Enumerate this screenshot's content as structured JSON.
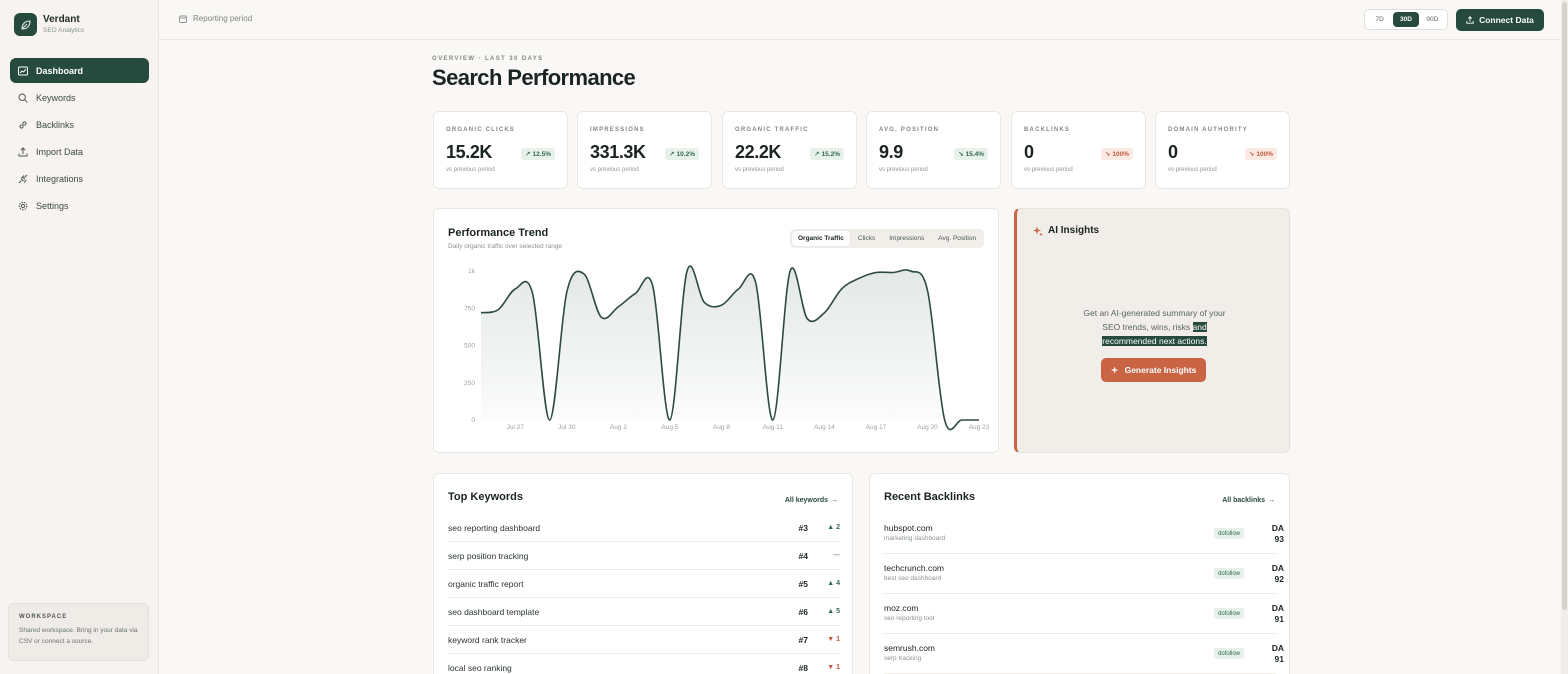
{
  "brand": {
    "name": "Verdant",
    "subtitle": "SEO Analytics"
  },
  "sidebar": {
    "items": [
      {
        "label": "Dashboard",
        "icon": "dashboard-icon",
        "active": true
      },
      {
        "label": "Keywords",
        "icon": "search-icon"
      },
      {
        "label": "Backlinks",
        "icon": "link-icon"
      },
      {
        "label": "Import Data",
        "icon": "upload-icon"
      },
      {
        "label": "Integrations",
        "icon": "plug-icon"
      },
      {
        "label": "Settings",
        "icon": "gear-icon"
      }
    ],
    "workspace": {
      "title": "WORKSPACE",
      "text": "Shared workspace. Bring in your data via CSV or connect a source."
    }
  },
  "topbar": {
    "period_label": "Reporting period",
    "ranges": [
      "7D",
      "30D",
      "90D"
    ],
    "active_range": "30D",
    "connect_label": "Connect Data"
  },
  "header": {
    "eyebrow": "OVERVIEW · LAST 30 DAYS",
    "title": "Search Performance"
  },
  "kpis": [
    {
      "label": "ORGANIC CLICKS",
      "value": "15.2K",
      "change": "12.5%",
      "direction": "up",
      "sub": "vs previous period"
    },
    {
      "label": "IMPRESSIONS",
      "value": "331.3K",
      "change": "10.2%",
      "direction": "up",
      "sub": "vs previous period"
    },
    {
      "label": "ORGANIC TRAFFIC",
      "value": "22.2K",
      "change": "15.2%",
      "direction": "up",
      "sub": "vs previous period"
    },
    {
      "label": "AVG. POSITION",
      "value": "9.9",
      "change": "15.4%",
      "direction": "up",
      "sub": "vs previous period"
    },
    {
      "label": "BACKLINKS",
      "value": "0",
      "change": "100%",
      "direction": "down",
      "sub": "vs previous period"
    },
    {
      "label": "DOMAIN AUTHORITY",
      "value": "0",
      "change": "100%",
      "direction": "down",
      "sub": "vs previous period"
    }
  ],
  "performance": {
    "title": "Performance Trend",
    "subtitle": "Daily organic traffic over selected range",
    "tabs": [
      "Organic Traffic",
      "Clicks",
      "Impressions",
      "Avg. Position"
    ],
    "active_tab": "Organic Traffic"
  },
  "chart_data": {
    "type": "area",
    "title": "Performance Trend",
    "xlabel": "",
    "ylabel": "",
    "ylim": [
      0,
      1000
    ],
    "yticks": [
      "0",
      "250",
      "500",
      "750",
      "1k"
    ],
    "xtick_labels": [
      "Jul 27",
      "Jul 30",
      "Aug 2",
      "Aug 5",
      "Aug 8",
      "Aug 11",
      "Aug 14",
      "Aug 17",
      "Aug 20",
      "Aug 23"
    ],
    "x": [
      "Jul 25",
      "Jul 26",
      "Jul 27",
      "Jul 28",
      "Jul 29",
      "Jul 30",
      "Jul 31",
      "Aug 1",
      "Aug 2",
      "Aug 3",
      "Aug 4",
      "Aug 5",
      "Aug 6",
      "Aug 7",
      "Aug 8",
      "Aug 9",
      "Aug 10",
      "Aug 11",
      "Aug 12",
      "Aug 13",
      "Aug 14",
      "Aug 15",
      "Aug 16",
      "Aug 17",
      "Aug 18",
      "Aug 19",
      "Aug 20",
      "Aug 21",
      "Aug 22",
      "Aug 23"
    ],
    "series": [
      {
        "values": [
          720,
          740,
          880,
          850,
          0,
          860,
          980,
          690,
          760,
          850,
          900,
          0,
          1000,
          790,
          770,
          880,
          920,
          0,
          1000,
          680,
          720,
          880,
          950,
          990,
          990,
          1000,
          870,
          0,
          0,
          0
        ]
      }
    ],
    "grid": false,
    "legend": "none"
  },
  "ai": {
    "title": "AI Insights",
    "text_before": "Get an AI-generated summary of your SEO trends, wins, risks ",
    "text_highlight": "and recommended next actions.",
    "button": "Generate Insights"
  },
  "keywords": {
    "title": "Top Keywords",
    "link": "All keywords",
    "rows": [
      {
        "keyword": "seo reporting dashboard",
        "rank": "#3",
        "change": "2",
        "direction": "up"
      },
      {
        "keyword": "serp position tracking",
        "rank": "#4",
        "change": "—",
        "direction": "flat"
      },
      {
        "keyword": "organic traffic report",
        "rank": "#5",
        "change": "4",
        "direction": "up"
      },
      {
        "keyword": "seo dashboard template",
        "rank": "#6",
        "change": "5",
        "direction": "up"
      },
      {
        "keyword": "keyword rank tracker",
        "rank": "#7",
        "change": "1",
        "direction": "down"
      },
      {
        "keyword": "local seo ranking",
        "rank": "#8",
        "change": "1",
        "direction": "down"
      }
    ]
  },
  "backlinks": {
    "title": "Recent Backlinks",
    "link": "All backlinks",
    "rows": [
      {
        "domain": "hubspot.com",
        "anchor": "marketing dashboard",
        "tag": "dofollow",
        "da_label": "DA",
        "da": "93"
      },
      {
        "domain": "techcrunch.com",
        "anchor": "best seo dashboard",
        "tag": "dofollow",
        "da_label": "DA",
        "da": "92"
      },
      {
        "domain": "moz.com",
        "anchor": "seo reporting tool",
        "tag": "dofollow",
        "da_label": "DA",
        "da": "91"
      },
      {
        "domain": "semrush.com",
        "anchor": "serp tracking",
        "tag": "dofollow",
        "da_label": "DA",
        "da": "91"
      }
    ]
  },
  "colors": {
    "brand": "#264a3e",
    "accent": "#c96445",
    "up": "#2f6b4e",
    "down": "#c2573a"
  }
}
